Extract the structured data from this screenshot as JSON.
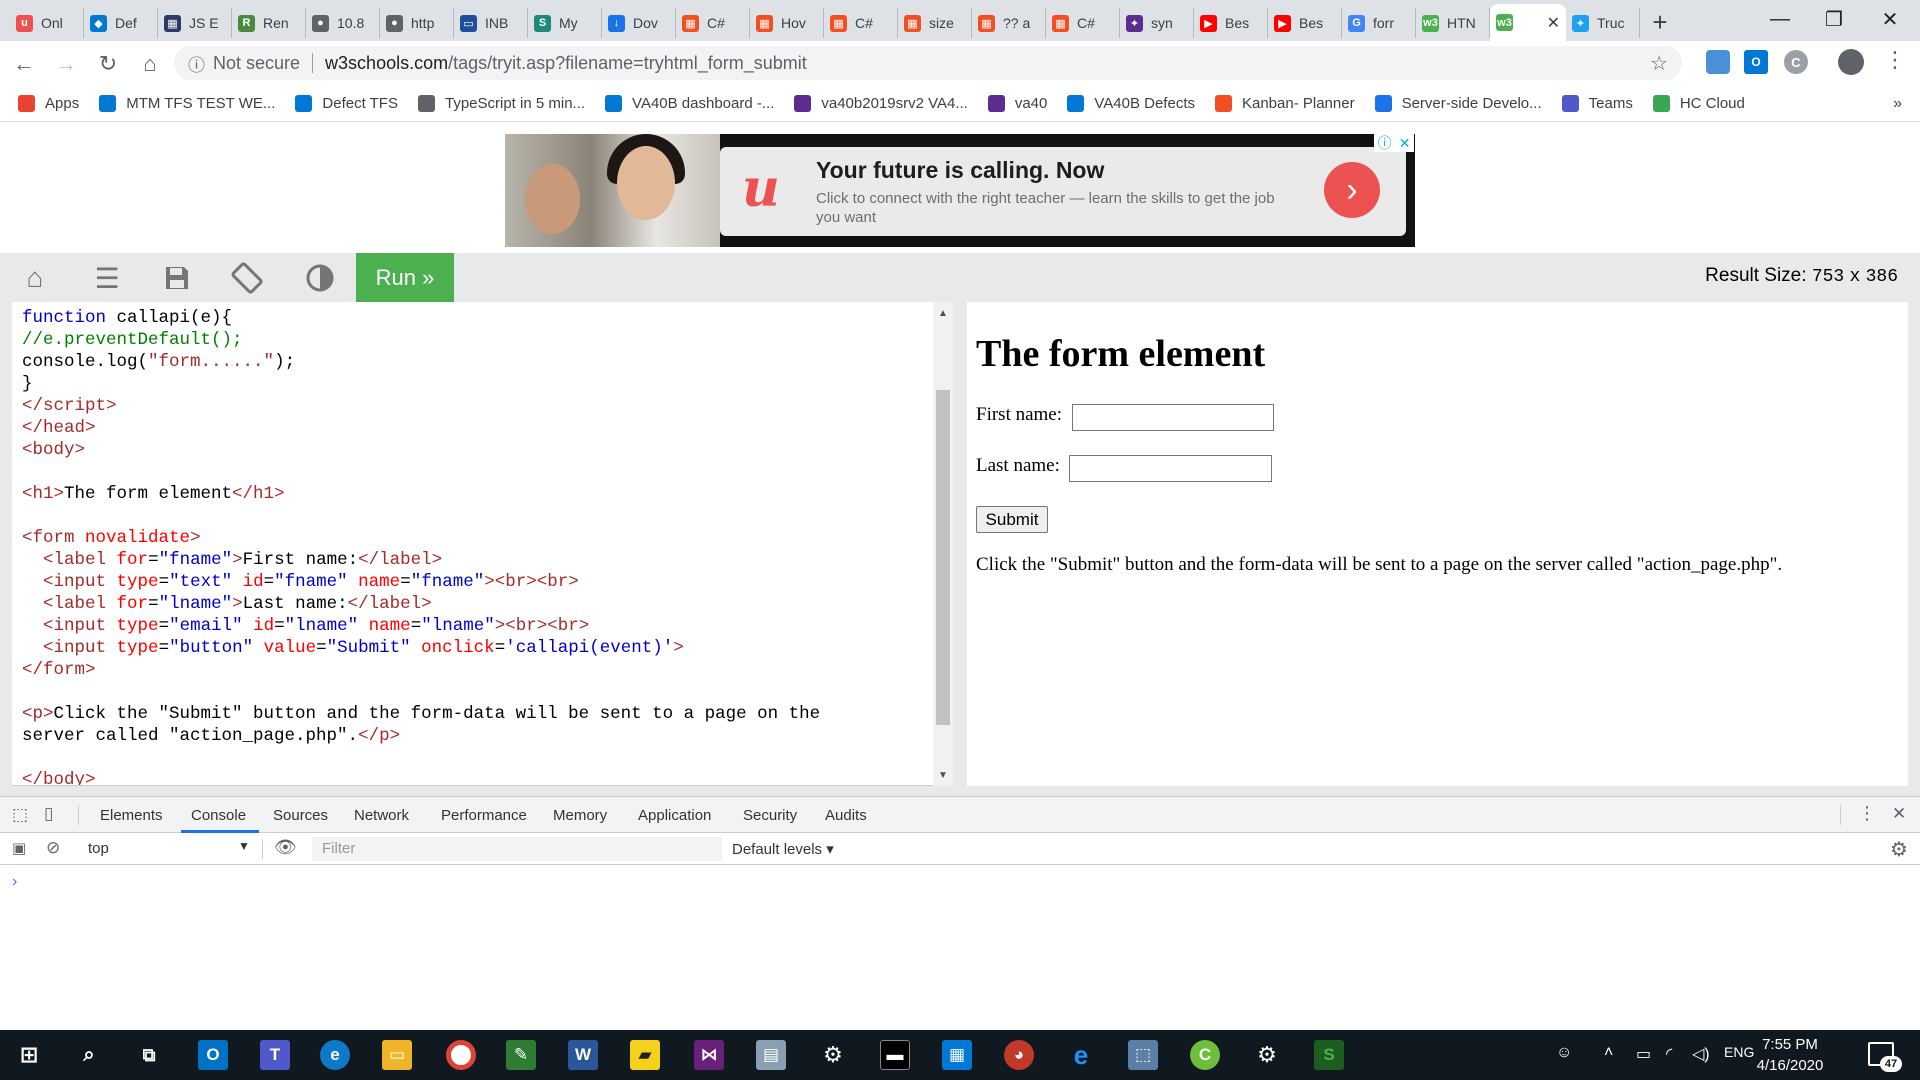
{
  "browser": {
    "tabs": [
      {
        "label": "Onl",
        "color": "#ec5252",
        "glyph": "u"
      },
      {
        "label": "Def",
        "color": "#0078d4",
        "glyph": "◆"
      },
      {
        "label": "JS E",
        "color": "#2b3a67",
        "glyph": "▦"
      },
      {
        "label": "Ren",
        "color": "#4c8a3d",
        "glyph": "R"
      },
      {
        "label": "10.8",
        "color": "#5f6368",
        "glyph": "●"
      },
      {
        "label": "http",
        "color": "#5f6368",
        "glyph": "●"
      },
      {
        "label": "INB",
        "color": "#1e4e9c",
        "glyph": "▭"
      },
      {
        "label": "My",
        "color": "#1c8a7a",
        "glyph": "S"
      },
      {
        "label": "Dov",
        "color": "#1a73e8",
        "glyph": "↓"
      },
      {
        "label": "C#",
        "color": "#f25022",
        "glyph": "▦"
      },
      {
        "label": "Hov",
        "color": "#f25022",
        "glyph": "▦"
      },
      {
        "label": "C#",
        "color": "#f25022",
        "glyph": "▦"
      },
      {
        "label": "size",
        "color": "#f25022",
        "glyph": "▦"
      },
      {
        "label": "?? a",
        "color": "#f25022",
        "glyph": "▦"
      },
      {
        "label": "C#",
        "color": "#f25022",
        "glyph": "▦"
      },
      {
        "label": "syn",
        "color": "#5c2d91",
        "glyph": "✦"
      },
      {
        "label": "Bes",
        "color": "#ff0000",
        "glyph": "▶"
      },
      {
        "label": "Bes",
        "color": "#ff0000",
        "glyph": "▶"
      },
      {
        "label": "forr",
        "color": "#4285f4",
        "glyph": "G"
      },
      {
        "label": "HTN",
        "color": "#4caf50",
        "glyph": "w3"
      }
    ],
    "active_tab": {
      "label": "",
      "color": "#4caf50",
      "glyph": "w3"
    },
    "after_tab": {
      "label": "Truc",
      "color": "#1da1f2",
      "glyph": "✦"
    },
    "security": "Not secure",
    "url_host": "w3schools.com",
    "url_path": "/tags/tryit.asp?filename=tryhtml_form_submit",
    "bookmarks": [
      {
        "label": "Apps",
        "color": "#ea4335"
      },
      {
        "label": "MTM TFS TEST WE...",
        "color": "#0078d4"
      },
      {
        "label": "Defect TFS",
        "color": "#0078d4"
      },
      {
        "label": "TypeScript in 5 min...",
        "color": "#5f6368"
      },
      {
        "label": "VA40B dashboard -...",
        "color": "#0078d4"
      },
      {
        "label": "va40b2019srv2 VA4...",
        "color": "#5c2d91"
      },
      {
        "label": "va40",
        "color": "#5c2d91"
      },
      {
        "label": "VA40B Defects",
        "color": "#0078d4"
      },
      {
        "label": "Kanban- Planner",
        "color": "#f25022"
      },
      {
        "label": "Server-side Develo...",
        "color": "#1a73e8"
      },
      {
        "label": "Teams",
        "color": "#5059c9"
      },
      {
        "label": "HC Cloud",
        "color": "#3aa757"
      }
    ],
    "more_bookmarks": "»"
  },
  "ad": {
    "headline": "Your future is calling. Now",
    "body": "Click to connect with the right teacher — learn the skills to get the job you want",
    "logo": "u",
    "go": "›"
  },
  "w3toolbar": {
    "run_label": "Run »",
    "result_size_label": "Result Size:",
    "result_width": "753",
    "result_x": "x",
    "result_height": "386"
  },
  "result": {
    "heading": "The form element",
    "first_label": "First name:",
    "last_label": "Last name:",
    "submit": "Submit",
    "paragraph": "Click the \"Submit\" button and the form-data will be sent to a page on the server called \"action_page.php\"."
  },
  "devtools": {
    "tabs": [
      "Elements",
      "Console",
      "Sources",
      "Network",
      "Performance",
      "Memory",
      "Application",
      "Security",
      "Audits"
    ],
    "context": "top",
    "filter_placeholder": "Filter",
    "levels": "Default levels ▾",
    "prompt": "›"
  },
  "taskbar": {
    "time": "7:55 PM",
    "date": "4/16/2020",
    "lang": "ENG",
    "notifications": "47"
  }
}
